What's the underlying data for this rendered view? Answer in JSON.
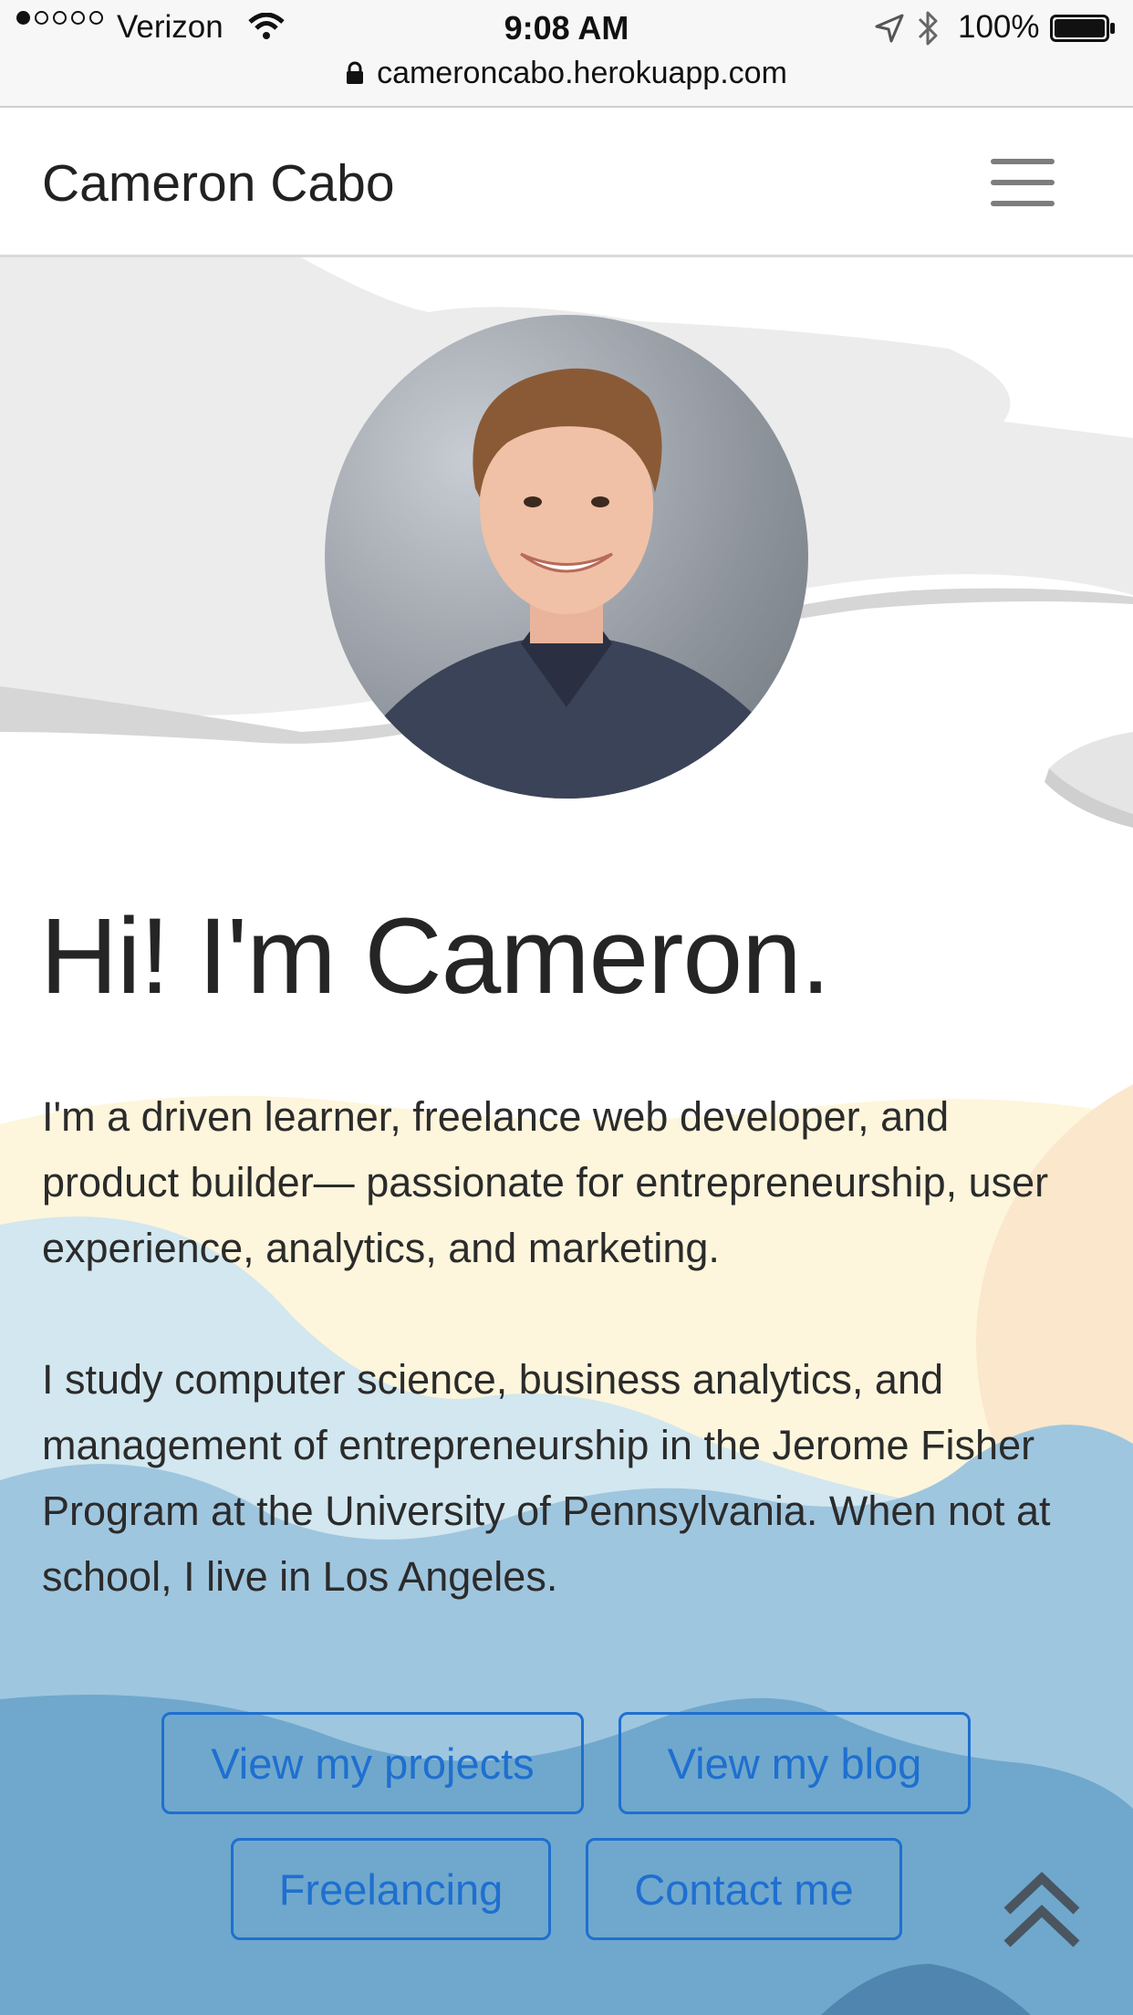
{
  "status_bar": {
    "carrier": "Verizon",
    "time": "9:08 AM",
    "battery": "100%",
    "url": "cameroncabo.herokuapp.com",
    "icons": [
      "signal-dots-icon",
      "wifi-icon",
      "location-arrow-icon",
      "bluetooth-icon",
      "battery-icon",
      "lock-icon"
    ]
  },
  "navbar": {
    "brand": "Cameron Cabo",
    "menu_icon": "hamburger-menu-icon"
  },
  "hero": {
    "avatar_alt": "Portrait photo of Cameron",
    "headline": "Hi! I'm Cameron.",
    "bio_paragraphs": [
      "I'm a driven learner, freelance web developer, and product builder— passionate for entrepreneurship, user experience, analytics, and marketing.",
      "I study computer science, business analytics, and management of entrepreneurship in the Jerome Fisher Program at the University of Pennsylvania. When not at school, I live in Los Angeles."
    ]
  },
  "buttons": {
    "projects": "View my projects",
    "blog": "View my blog",
    "freelancing": "Freelancing",
    "contact": "Contact me"
  },
  "back_to_top_icon": "double-chevron-up-icon",
  "colors": {
    "accent": "#1f6fd0",
    "text": "#2b2b2b",
    "cloud": "#ececec",
    "sun_yellow": "#fdf6dc",
    "mountain_light": "#d2e7ef",
    "mountain_mid": "#9fc6df",
    "mountain_dark": "#6fa8cc"
  }
}
